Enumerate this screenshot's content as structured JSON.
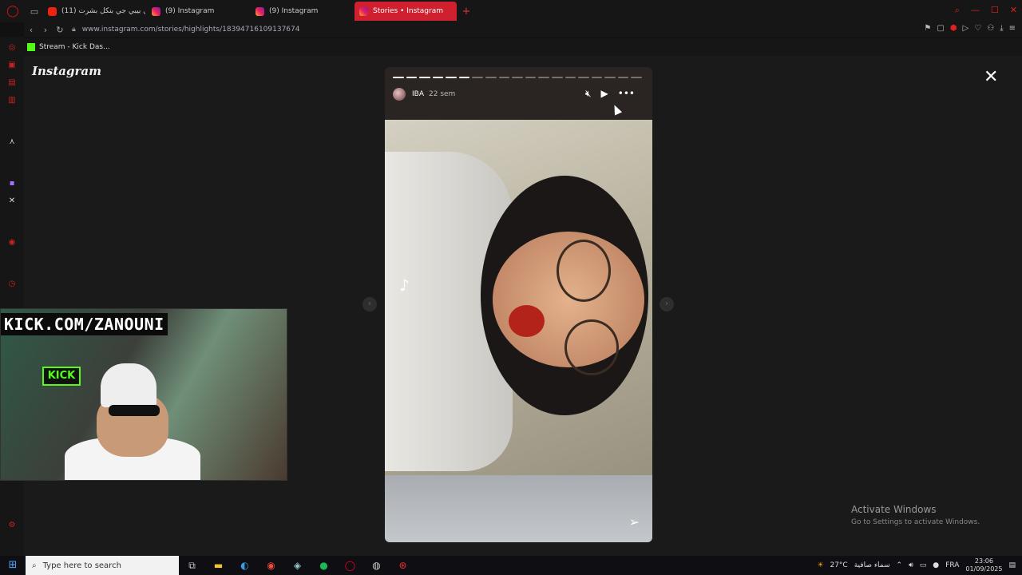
{
  "browser": {
    "tabs": [
      {
        "title": "(11) كلاي بيبي جي بنكل بشرت..",
        "icon": "youtube-icon",
        "active": false
      },
      {
        "title": "(9) Instagram",
        "icon": "instagram-icon",
        "active": false
      },
      {
        "title": "(9) Instagram",
        "icon": "instagram-icon",
        "active": false
      },
      {
        "title": "Stories • Instagram",
        "icon": "instagram-icon",
        "active": true
      }
    ],
    "url": "www.instagram.com/stories/highlights/18394716109137674",
    "bookmark": "Stream - Kick Das..."
  },
  "page": {
    "logo": "Instagram",
    "story": {
      "username": "IBA",
      "time": "22 sem",
      "progress_done": 6,
      "progress_total": 19
    }
  },
  "webcam": {
    "banner": "KICK.COM/ZANOUNI",
    "sign": "KICK"
  },
  "watermark": {
    "title": "Activate Windows",
    "subtitle": "Go to Settings to activate Windows."
  },
  "taskbar": {
    "search_placeholder": "Type here to search",
    "weather": "27°C",
    "weather_text": "سماء صافية",
    "language": "FRA",
    "time": "23:06",
    "date": "01/09/2025"
  },
  "colors": {
    "active_tab": "#d01f2f",
    "kick_green": "#53fc18"
  }
}
